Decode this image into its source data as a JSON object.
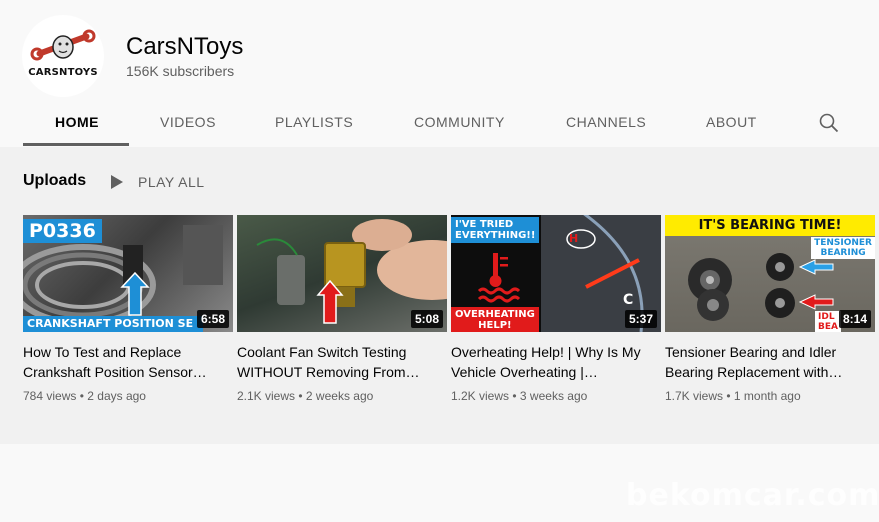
{
  "channel": {
    "name": "CarsNToys",
    "subscribers": "156K subscribers",
    "avatar_text": "CARSNTOYS"
  },
  "tabs": [
    {
      "label": "HOME",
      "active": true
    },
    {
      "label": "VIDEOS",
      "active": false
    },
    {
      "label": "PLAYLISTS",
      "active": false
    },
    {
      "label": "COMMUNITY",
      "active": false
    },
    {
      "label": "CHANNELS",
      "active": false
    },
    {
      "label": "ABOUT",
      "active": false
    }
  ],
  "search": {
    "icon": "search-icon"
  },
  "section": {
    "title": "Uploads",
    "play_all_label": "PLAY ALL"
  },
  "videos": [
    {
      "title": "How To Test and Replace Crankshaft Position Sensor…",
      "views": "784 views",
      "age": "2 days ago",
      "duration": "6:58",
      "thumb_top_text": "P0336",
      "thumb_bottom_text": "CRANKSHAFT POSITION SE"
    },
    {
      "title": "Coolant Fan Switch Testing WITHOUT Removing From…",
      "views": "2.1K views",
      "age": "2 weeks ago",
      "duration": "5:08"
    },
    {
      "title": "Overheating Help! | Why Is My Vehicle Overheating |…",
      "views": "1.2K views",
      "age": "3 weeks ago",
      "duration": "5:37",
      "thumb_top_text_1": "I'VE TRIED",
      "thumb_top_text_2": "EVERYTHING!!",
      "thumb_bottom_text_1": "OVERHEATING",
      "thumb_bottom_text_2": "HELP!",
      "gauge_h": "H",
      "gauge_c": "C"
    },
    {
      "title": "Tensioner Bearing and Idler Bearing Replacement with…",
      "views": "1.7K views",
      "age": "1 month ago",
      "duration": "8:14",
      "thumb_top_text": "IT'S BEARING TIME!",
      "thumb_label_1": "TENSIONER",
      "thumb_label_2": "BEARING",
      "thumb_label_3": "IDL",
      "thumb_label_4": "BEA"
    }
  ],
  "watermark": "bekomcar.com",
  "colors": {
    "thumb_blue": "#1e8fd6",
    "thumb_red": "#e11b1b",
    "thumb_yellow": "#ffeb00"
  }
}
